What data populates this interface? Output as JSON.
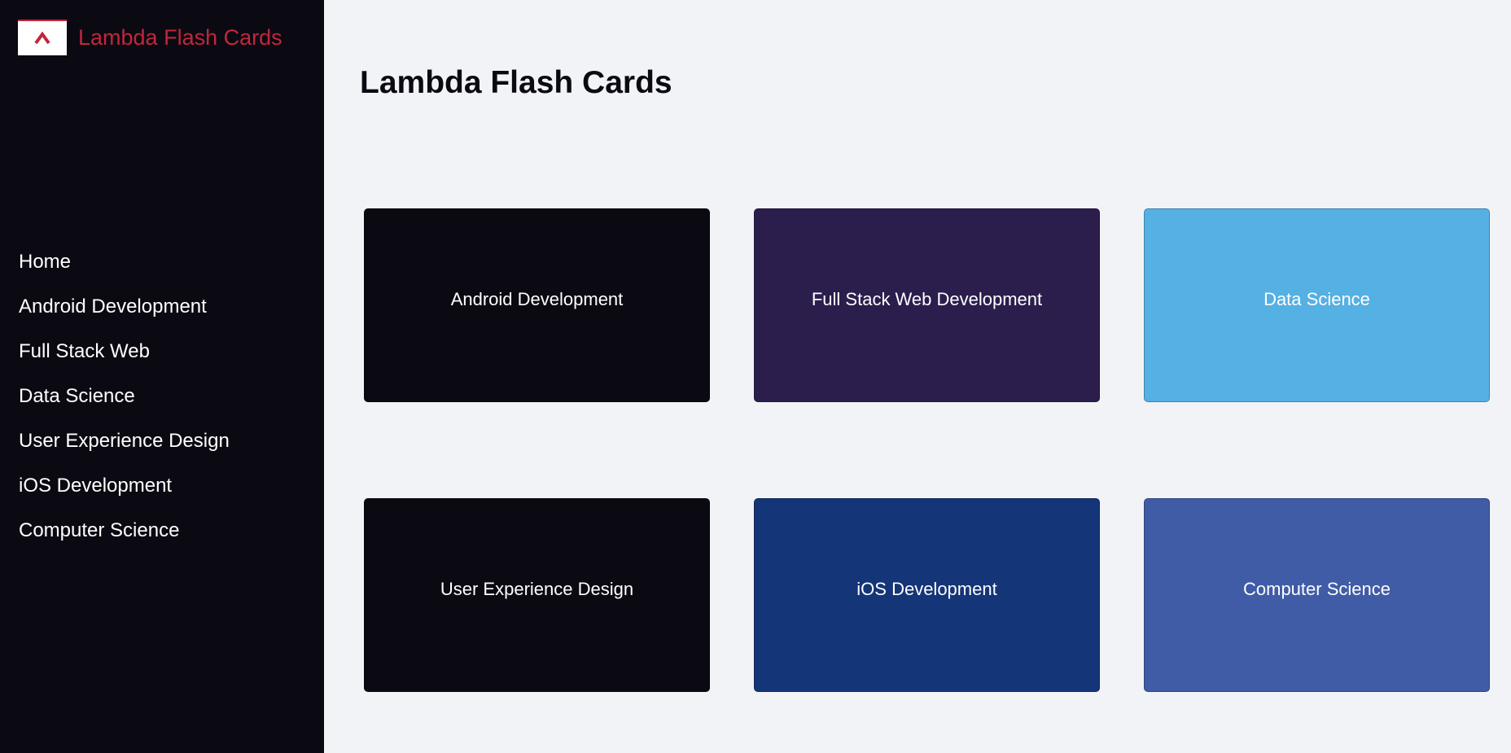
{
  "brand": {
    "name": "Lambda Flash Cards",
    "logo_icon": "lambda-chevron-icon",
    "accent_color": "#c2263a"
  },
  "nav": {
    "items": [
      {
        "label": "Home"
      },
      {
        "label": "Android Development"
      },
      {
        "label": "Full Stack Web"
      },
      {
        "label": "Data Science"
      },
      {
        "label": "User Experience Design"
      },
      {
        "label": "iOS Development"
      },
      {
        "label": "Computer Science"
      }
    ]
  },
  "main": {
    "title": "Lambda Flash Cards",
    "cards": [
      {
        "label": "Android Development",
        "color": "#0b0a13"
      },
      {
        "label": "Full Stack Web Development",
        "color": "#2b1e4d"
      },
      {
        "label": "Data Science",
        "color": "#55b0e3"
      },
      {
        "label": "User Experience Design",
        "color": "#0b0a13"
      },
      {
        "label": "iOS Development",
        "color": "#143577"
      },
      {
        "label": "Computer Science",
        "color": "#405ca6"
      }
    ]
  }
}
